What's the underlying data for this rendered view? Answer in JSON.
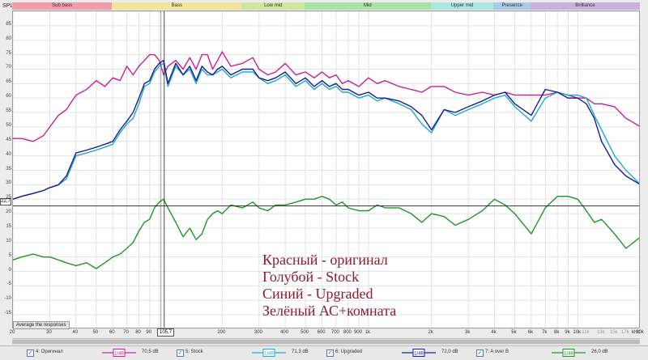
{
  "y_axis_label": "SPL",
  "bands": [
    {
      "label": "Sub bass",
      "color": "#f29cab",
      "f0": 20,
      "f1": 60
    },
    {
      "label": "Bass",
      "color": "#f4e39a",
      "f0": 60,
      "f1": 250
    },
    {
      "label": "Low mid",
      "color": "#cfe89e",
      "f0": 250,
      "f1": 500
    },
    {
      "label": "Mid",
      "color": "#a9e3a4",
      "f0": 500,
      "f1": 2000
    },
    {
      "label": "Upper mid",
      "color": "#a9e6dc",
      "f0": 2000,
      "f1": 4000
    },
    {
      "label": "Presence",
      "color": "#aacbe8",
      "f0": 4000,
      "f1": 6000
    },
    {
      "label": "Brilliance",
      "color": "#c7b1df",
      "f0": 6000,
      "f1": 20000
    }
  ],
  "cursor": {
    "y_label": "22,7",
    "y_value": 22.7,
    "x_label": "105,7",
    "x_value": 105.7
  },
  "average_button": "Average the responses",
  "x_unit": "kHz",
  "legend": [
    {
      "name": "4: Оригинал",
      "db": "70,5 dB",
      "color": "#cc1e96",
      "swatch_text": "1/48"
    },
    {
      "name": "5: Stock",
      "db": "71,3 dB",
      "color": "#1eaac8",
      "swatch_text": "1/48"
    },
    {
      "name": "6: Upgraded",
      "db": "72,0 dB",
      "color": "#141e96",
      "swatch_text": "1/48"
    },
    {
      "name": "7: A over B",
      "db": "26,0 dB",
      "color": "#1e9628",
      "swatch_text": "1/48"
    }
  ],
  "annotations": [
    "Красный - оригинал",
    "Голубой - Stock",
    "Синий - Upgraded",
    "Зелёный АС+комната"
  ],
  "chart_data": {
    "type": "line",
    "x_scale": "log",
    "xlim": [
      20,
      20000
    ],
    "ylim": [
      -20,
      90
    ],
    "ylabel": "SPL",
    "xlabel": "",
    "grid": true,
    "y_ticks": [
      -15,
      -10,
      -5,
      0,
      5,
      10,
      15,
      20,
      25,
      30,
      35,
      40,
      45,
      50,
      55,
      60,
      65,
      70,
      75,
      80,
      85
    ],
    "x_ticks": [
      {
        "v": 20,
        "l": "20"
      },
      {
        "v": 30,
        "l": "30"
      },
      {
        "v": 40,
        "l": "40"
      },
      {
        "v": 50,
        "l": "50"
      },
      {
        "v": 60,
        "l": "60"
      },
      {
        "v": 70,
        "l": "70"
      },
      {
        "v": 80,
        "l": "80"
      },
      {
        "v": 90,
        "l": "90"
      },
      {
        "v": 200,
        "l": "200"
      },
      {
        "v": 300,
        "l": "300"
      },
      {
        "v": 400,
        "l": "400"
      },
      {
        "v": 500,
        "l": "500"
      },
      {
        "v": 600,
        "l": "600"
      },
      {
        "v": 700,
        "l": "700"
      },
      {
        "v": 800,
        "l": "800"
      },
      {
        "v": 900,
        "l": "900"
      },
      {
        "v": 1000,
        "l": "1k"
      },
      {
        "v": 2000,
        "l": "2k"
      },
      {
        "v": 3000,
        "l": "3k"
      },
      {
        "v": 4000,
        "l": "4k"
      },
      {
        "v": 5000,
        "l": "5k"
      },
      {
        "v": 6000,
        "l": "6k"
      },
      {
        "v": 7000,
        "l": "7k"
      },
      {
        "v": 8000,
        "l": "8k"
      },
      {
        "v": 9000,
        "l": "9k"
      },
      {
        "v": 10000,
        "l": "10k"
      },
      {
        "v": 11000,
        "l": "11k"
      },
      {
        "v": 13000,
        "l": "13k"
      },
      {
        "v": 15000,
        "l": "15k"
      },
      {
        "v": 17000,
        "l": "17k"
      },
      {
        "v": 20000,
        "l": "20k"
      }
    ],
    "series": [
      {
        "name": "4: Оригинал",
        "color": "#cc1e96",
        "x": [
          20,
          22,
          25,
          28,
          30,
          33,
          36,
          40,
          45,
          50,
          55,
          60,
          65,
          70,
          75,
          80,
          85,
          90,
          95,
          100,
          105,
          110,
          120,
          130,
          140,
          150,
          160,
          170,
          180,
          190,
          200,
          220,
          250,
          280,
          300,
          330,
          360,
          400,
          450,
          500,
          550,
          600,
          650,
          700,
          750,
          800,
          900,
          1000,
          1100,
          1200,
          1400,
          1600,
          1800,
          2000,
          2300,
          2600,
          3000,
          3500,
          4000,
          4500,
          5000,
          6000,
          7000,
          8000,
          9000,
          10000,
          11000,
          12000,
          13000,
          15000,
          17000,
          20000
        ],
        "y": [
          46,
          46,
          45,
          47,
          50,
          54,
          56,
          61,
          63,
          66,
          64,
          67,
          66,
          71,
          68,
          71,
          73,
          75,
          75,
          73,
          68,
          71,
          73,
          70,
          74,
          70,
          75,
          75,
          70,
          73,
          76,
          71,
          72,
          74,
          70,
          68,
          69,
          72,
          68,
          69,
          67,
          69,
          67,
          68,
          65,
          66,
          64,
          67,
          65,
          66,
          64,
          63,
          62,
          64,
          64,
          62,
          61,
          62,
          61,
          62,
          61,
          61,
          61,
          62,
          61,
          60,
          60,
          58,
          58,
          57,
          53,
          50
        ]
      },
      {
        "name": "5: Stock",
        "color": "#1eaac8",
        "x": [
          20,
          22,
          25,
          28,
          30,
          33,
          36,
          40,
          45,
          50,
          55,
          60,
          65,
          70,
          75,
          80,
          85,
          90,
          95,
          100,
          105,
          110,
          120,
          130,
          140,
          150,
          160,
          170,
          180,
          190,
          200,
          220,
          250,
          280,
          300,
          330,
          360,
          400,
          450,
          500,
          550,
          600,
          650,
          700,
          750,
          800,
          900,
          1000,
          1100,
          1200,
          1400,
          1600,
          1800,
          2000,
          2300,
          2600,
          3000,
          3500,
          4000,
          4500,
          5000,
          6000,
          7000,
          8000,
          9000,
          10000,
          11000,
          12000,
          13000,
          15000,
          17000,
          20000
        ],
        "y": [
          25,
          26,
          27,
          28,
          29,
          30,
          32,
          40,
          41,
          42,
          43,
          44,
          48,
          51,
          53,
          58,
          64,
          65,
          69,
          71,
          72,
          64,
          71,
          68,
          70,
          65,
          70,
          68,
          68,
          69,
          70,
          67,
          69,
          69,
          67,
          65,
          66,
          68,
          64,
          66,
          63,
          65,
          63,
          64,
          62,
          62,
          60,
          61,
          59,
          60,
          58,
          56,
          51,
          48,
          56,
          54,
          56,
          58,
          60,
          61,
          57,
          52,
          60,
          62,
          61,
          61,
          60,
          54,
          49,
          40,
          35,
          30
        ]
      },
      {
        "name": "6: Upgraded",
        "color": "#141e96",
        "x": [
          20,
          22,
          25,
          28,
          30,
          33,
          36,
          40,
          45,
          50,
          55,
          60,
          65,
          70,
          75,
          80,
          85,
          90,
          95,
          100,
          105,
          110,
          120,
          130,
          140,
          150,
          160,
          170,
          180,
          190,
          200,
          220,
          250,
          280,
          300,
          330,
          360,
          400,
          450,
          500,
          550,
          600,
          650,
          700,
          750,
          800,
          900,
          1000,
          1100,
          1200,
          1400,
          1600,
          1800,
          2000,
          2300,
          2600,
          3000,
          3500,
          4000,
          4500,
          5000,
          6000,
          7000,
          8000,
          9000,
          10000,
          11000,
          12000,
          13000,
          15000,
          17000,
          20000
        ],
        "y": [
          25,
          26,
          27,
          28,
          29,
          30,
          33,
          41,
          42,
          43,
          44,
          45,
          49,
          52,
          55,
          60,
          65,
          66,
          70,
          72,
          73,
          65,
          72,
          68,
          71,
          66,
          71,
          69,
          68,
          70,
          71,
          68,
          70,
          70,
          67,
          66,
          67,
          69,
          65,
          67,
          64,
          66,
          64,
          65,
          63,
          63,
          61,
          62,
          60,
          60,
          59,
          57,
          54,
          49,
          56,
          55,
          57,
          59,
          61,
          62,
          58,
          54,
          63,
          62,
          60,
          60,
          58,
          53,
          45,
          37,
          33,
          30
        ]
      },
      {
        "name": "7: A over B",
        "color": "#1e9628",
        "x": [
          20,
          22,
          25,
          28,
          30,
          33,
          36,
          40,
          45,
          50,
          55,
          60,
          65,
          70,
          75,
          80,
          85,
          90,
          95,
          100,
          105,
          110,
          120,
          130,
          140,
          150,
          160,
          170,
          180,
          190,
          200,
          220,
          250,
          280,
          300,
          330,
          360,
          400,
          450,
          500,
          550,
          600,
          650,
          700,
          750,
          800,
          900,
          1000,
          1100,
          1200,
          1400,
          1600,
          1800,
          2000,
          2300,
          2600,
          3000,
          3500,
          4000,
          4500,
          5000,
          6000,
          7000,
          8000,
          9000,
          10000,
          11000,
          12000,
          13000,
          15000,
          17000,
          20000
        ],
        "y": [
          4,
          5,
          6,
          5,
          5,
          4,
          3,
          2,
          3,
          1,
          3,
          5,
          6,
          8,
          10,
          14,
          17,
          18,
          22,
          24,
          25,
          22,
          17,
          12,
          15,
          11,
          13,
          18,
          20,
          21,
          20,
          23,
          22,
          24,
          22,
          21,
          23,
          23,
          24,
          25,
          25,
          26,
          25,
          23,
          24,
          22,
          21,
          21,
          23,
          22,
          22,
          20,
          17,
          20,
          19,
          16,
          18,
          21,
          25,
          23,
          20,
          13,
          22,
          26,
          26,
          25,
          21,
          17,
          18,
          13,
          8,
          12
        ]
      }
    ]
  }
}
